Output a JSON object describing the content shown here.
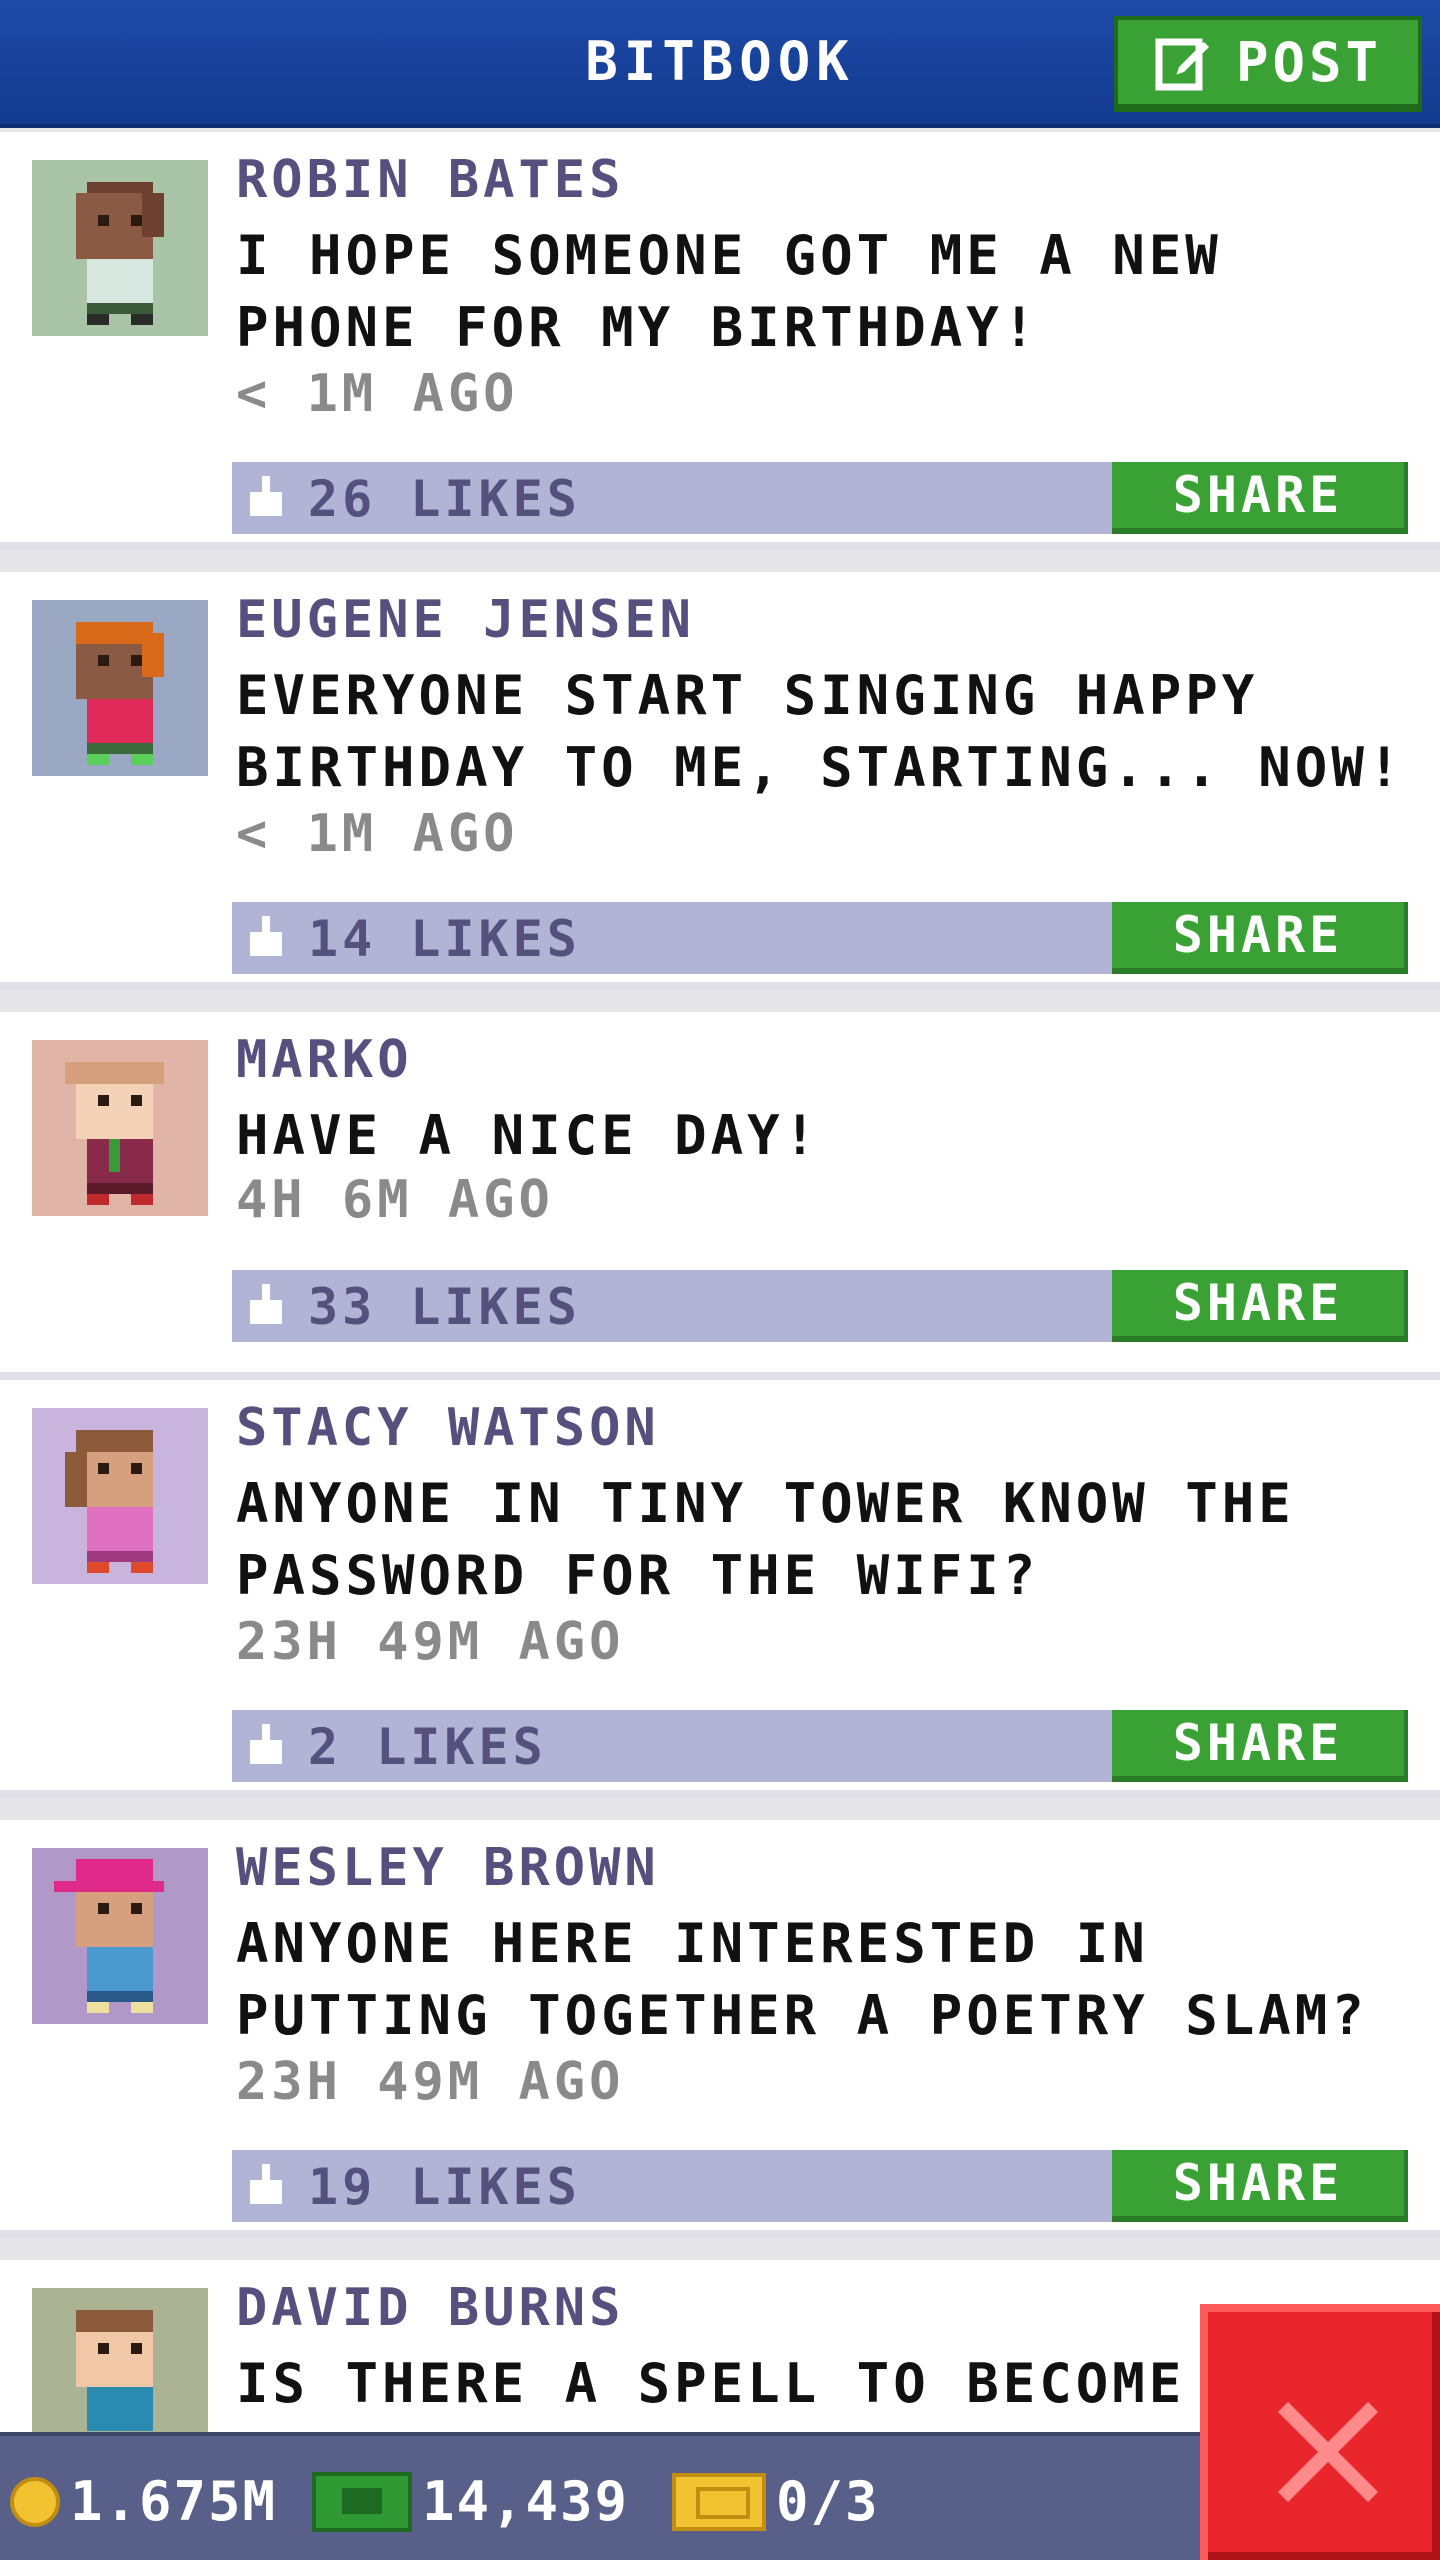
{
  "header": {
    "title": "BITBOOK",
    "post_label": "POST"
  },
  "posts": [
    {
      "author": "ROBIN BATES",
      "message": "I HOPE SOMEONE GOT ME A NEW PHONE FOR MY BIRTHDAY!",
      "time": "< 1M AGO",
      "likes": "26 LIKES",
      "share_label": "SHARE",
      "avatar_bg": "#aac4a8"
    },
    {
      "author": "EUGENE JENSEN",
      "message": "EVERYONE START SINGING HAPPY BIRTHDAY TO ME, STARTING... NOW!",
      "time": "< 1M AGO",
      "likes": "14 LIKES",
      "share_label": "SHARE",
      "avatar_bg": "#9aa8c4"
    },
    {
      "author": "MARKO",
      "message": "HAVE A NICE DAY!",
      "time": "4H 6M AGO",
      "likes": "33 LIKES",
      "share_label": "SHARE",
      "avatar_bg": "#e0b4a6"
    },
    {
      "author": "STACY WATSON",
      "message": "ANYONE IN TINY TOWER KNOW THE PASSWORD FOR THE WIFI?",
      "time": "23H 49M AGO",
      "likes": "2 LIKES",
      "share_label": "SHARE",
      "avatar_bg": "#c8b4dc"
    },
    {
      "author": "WESLEY BROWN",
      "message": "ANYONE HERE INTERESTED IN PUTTING TOGETHER A POETRY SLAM?",
      "time": "23H 49M AGO",
      "likes": "19 LIKES",
      "share_label": "SHARE",
      "avatar_bg": "#b098c8"
    },
    {
      "author": "DAVID BURNS",
      "message": "IS THERE A SPELL TO BECOME A",
      "avatar_bg": "#aab494"
    }
  ],
  "status_bar": {
    "coins": "1.675M",
    "bux": "14,439",
    "tickets": "0/3"
  },
  "colors": {
    "header_blue": "#1e4aa8",
    "accent_green": "#3aa235",
    "like_bar": "#b2b4d6",
    "close_red": "#e8262c"
  }
}
